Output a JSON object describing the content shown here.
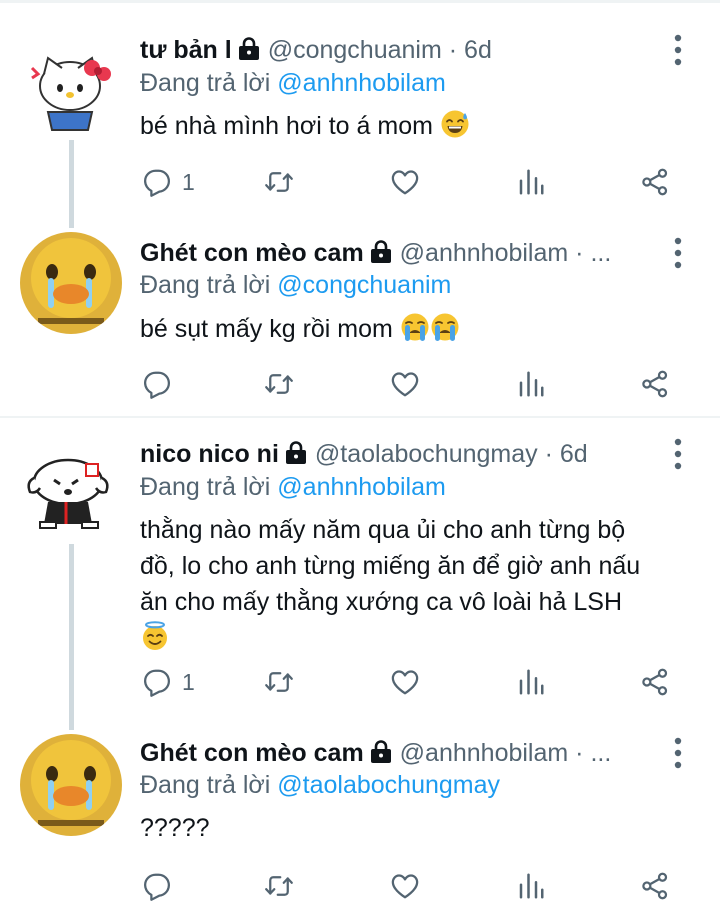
{
  "tweets": [
    {
      "name": "tư bản l",
      "handle": "@congchuanim",
      "time": "· 6d",
      "reply_label": "Đang trả lời ",
      "reply_to": "@anhnhobilam",
      "text": "bé nhà mình hơi to á mom",
      "emoji": "sweat-smile",
      "reply_count": "1",
      "avatar": "hello-kitty"
    },
    {
      "name": "Ghét con mèo cam",
      "handle": "@anhnhobilam",
      "time": "· ...",
      "reply_label": "Đang trả lời ",
      "reply_to": "@congchuanim",
      "text": "bé sụt mấy kg rồi mom",
      "emoji": "crying",
      "reply_count": "",
      "avatar": "yellow-duck"
    },
    {
      "name": "nico nico ni",
      "handle": "@taolabochungmay",
      "time": "· 6d",
      "reply_label": "Đang trả lời ",
      "reply_to": "@anhnhobilam",
      "text_lines": [
        "thằng nào mấy năm qua ủi cho anh từng bộ",
        "đồ, lo cho anh từng miếng ăn để giờ anh nấu",
        "ăn cho mấy thằng xướng ca vô loài hả LSH"
      ],
      "emoji": "halo-smile",
      "reply_count": "1",
      "avatar": "white-dog"
    },
    {
      "name": "Ghét con mèo cam",
      "handle": "@anhnhobilam",
      "time": "· ...",
      "reply_label": "Đang trả lời ",
      "reply_to": "@taolabochungmay",
      "text": "?????",
      "reply_count": "",
      "avatar": "yellow-duck"
    }
  ],
  "icons": {
    "reply": "comment-icon",
    "retweet": "retweet-icon",
    "like": "heart-icon",
    "views": "bar-chart-icon",
    "share": "share-icon",
    "more": "more-vertical-icon"
  },
  "colors": {
    "accent": "#1d9bf0",
    "secondary_text": "#536471",
    "icon": "#536471",
    "divider": "#eff3f4"
  }
}
